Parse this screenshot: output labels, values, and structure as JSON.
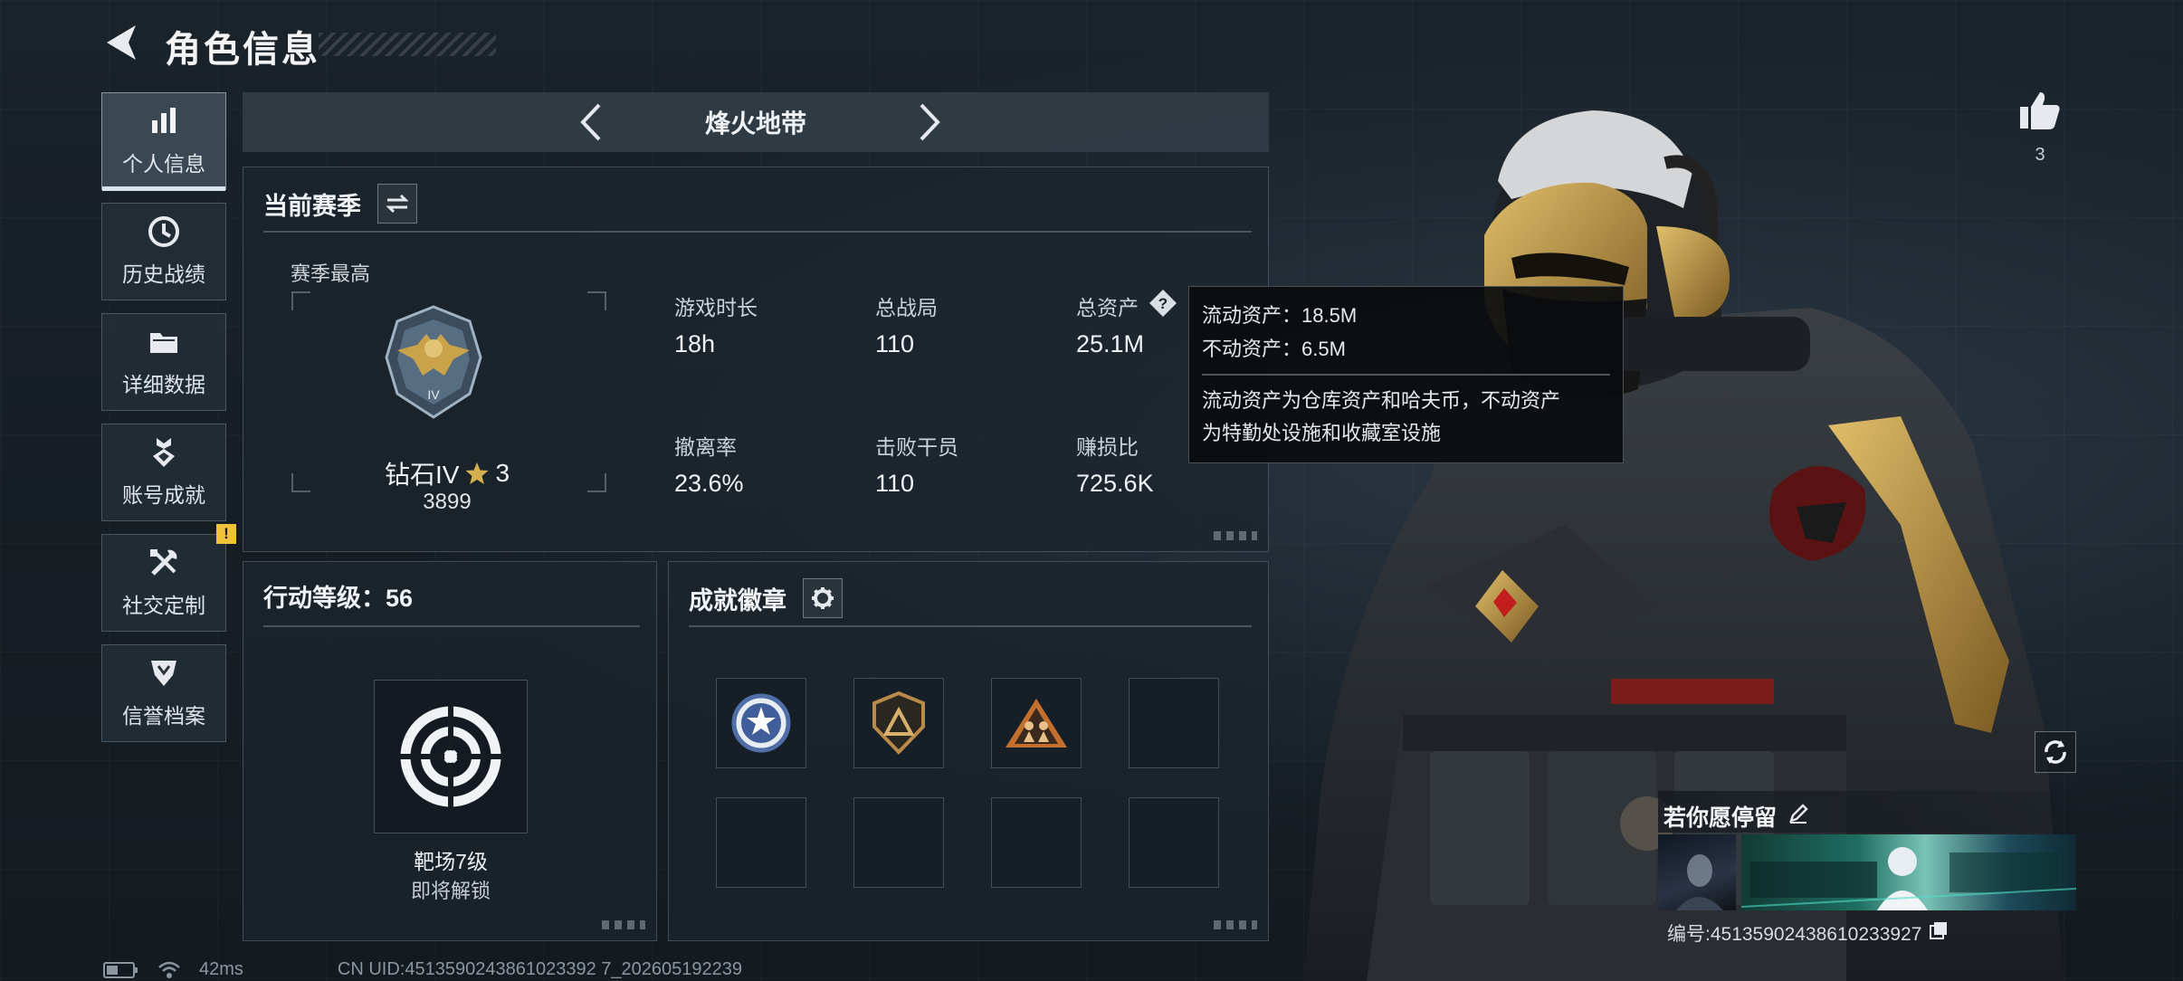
{
  "header": {
    "title": "角色信息"
  },
  "sidebar": {
    "items": [
      {
        "label": "个人信息",
        "icon": "bar-chart-icon",
        "active": true
      },
      {
        "label": "历史战绩",
        "icon": "history-clock-icon"
      },
      {
        "label": "详细数据",
        "icon": "folder-icon"
      },
      {
        "label": "账号成就",
        "icon": "medal-icon"
      },
      {
        "label": "社交定制",
        "icon": "tools-icon",
        "badge": "!"
      },
      {
        "label": "信誉档案",
        "icon": "shield-emblem-icon"
      }
    ]
  },
  "mode": {
    "name": "烽火地带"
  },
  "season": {
    "title": "当前赛季",
    "best_label": "赛季最高",
    "rank": "钻石IV",
    "rank_stars": "3",
    "rank_emblem_text": "IV",
    "rank_points": "3899",
    "stats": [
      {
        "label": "游戏时长",
        "value": "18h"
      },
      {
        "label": "总战局",
        "value": "110"
      },
      {
        "label": "总资产",
        "value": "25.1M"
      },
      {
        "label": "撤离率",
        "value": "23.6%"
      },
      {
        "label": "击败干员",
        "value": "110"
      },
      {
        "label": "赚损比",
        "value": "725.6K"
      }
    ]
  },
  "tooltip": {
    "liquid": "流动资产：18.5M",
    "fixed": "不动资产：6.5M",
    "desc1": "流动资产为仓库资产和哈夫币，不动资产",
    "desc2": "为特勤处设施和收藏室设施"
  },
  "action_level": {
    "title": "行动等级：56",
    "item_name": "靶场7级",
    "item_status": "即将解锁"
  },
  "achievements": {
    "title": "成就徽章"
  },
  "profile": {
    "likes": "3",
    "nickname": "若你愿停留",
    "id_text": "编号:451359024386102339​27"
  },
  "footer": {
    "ping": "42ms",
    "uid": "CN UID:4513590243861023392 7_202605192239"
  },
  "colors": {
    "accent_gold": "#c9a24a",
    "badge_yellow": "#f0c23a",
    "panel_bg": "#1c242c"
  }
}
